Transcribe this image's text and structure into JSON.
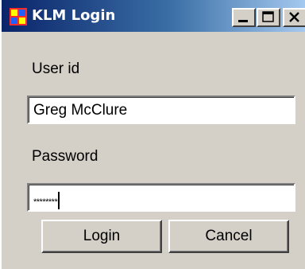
{
  "window": {
    "title": "KLM Login",
    "icon": "app-window-icon",
    "controls": [
      "minimize-icon",
      "maximize-icon",
      "close-icon"
    ]
  },
  "form": {
    "user_id_label": "User id",
    "user_id_value": "Greg McClure",
    "password_label": "Password",
    "password_value": "********"
  },
  "buttons": {
    "login_label": "Login",
    "cancel_label": "Cancel"
  },
  "colors": {
    "titlebar_start": "#0a246a",
    "titlebar_end": "#a6caf0",
    "face": "#d4d0c8"
  }
}
